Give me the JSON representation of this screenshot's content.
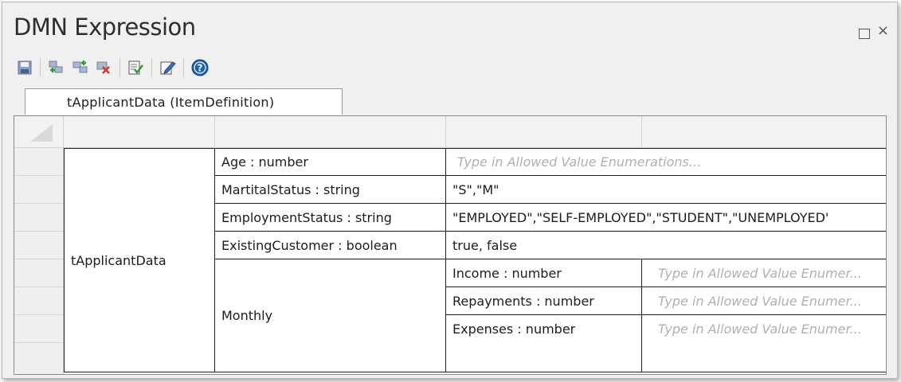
{
  "window": {
    "title": "DMN Expression",
    "maximize_icon": "square-icon",
    "close_glyph": "×"
  },
  "toolbar": {
    "buttons": [
      "save-icon",
      "add-child-icon",
      "add-sibling-icon",
      "delete-icon",
      "validate-icon",
      "edit-icon",
      "help-icon"
    ]
  },
  "tabs": [
    {
      "label": "tApplicantData (ItemDefinition)",
      "active": true
    }
  ],
  "table": {
    "root_name": "tApplicantData",
    "components": [
      {
        "label": "Age : number",
        "allowed": "Type in Allowed Value Enumerations...",
        "is_placeholder": true
      },
      {
        "label": "MartitalStatus : string",
        "allowed": "\"S\",\"M\"",
        "is_placeholder": false
      },
      {
        "label": "EmploymentStatus : string",
        "allowed": "\"EMPLOYED\",\"SELF-EMPLOYED\",\"STUDENT\",\"UNEMPLOYED'",
        "is_placeholder": false
      },
      {
        "label": "ExistingCustomer : boolean",
        "allowed": "true, false",
        "is_placeholder": false
      }
    ],
    "group": {
      "label": "Monthly",
      "children": [
        {
          "label": "Income : number",
          "allowed": "Type in Allowed Value Enumer...",
          "is_placeholder": true
        },
        {
          "label": "Repayments : number",
          "allowed": "Type in Allowed Value Enumer...",
          "is_placeholder": true
        },
        {
          "label": "Expenses : number",
          "allowed": "Type in Allowed Value Enumer...",
          "is_placeholder": true
        }
      ]
    }
  }
}
